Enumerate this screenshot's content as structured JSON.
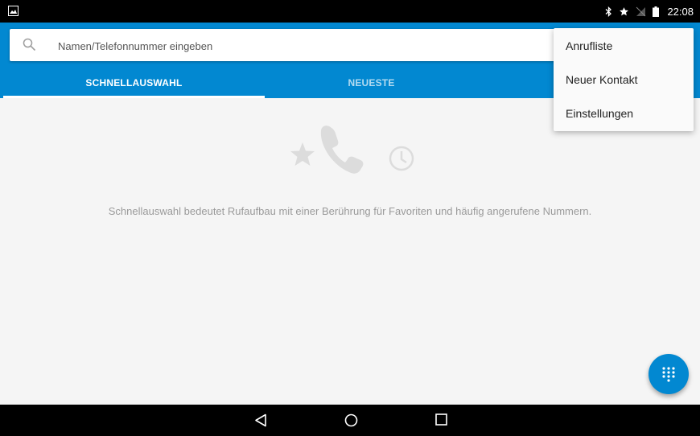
{
  "status_bar": {
    "time": "22:08",
    "icons": [
      "image-notification-icon",
      "bluetooth-icon",
      "star-icon",
      "no-signal-icon",
      "battery-icon"
    ]
  },
  "search": {
    "placeholder": "Namen/Telefonnummer eingeben",
    "value": ""
  },
  "tabs": [
    {
      "label": "SCHNELLAUSWAHL",
      "selected": true
    },
    {
      "label": "NEUESTE",
      "selected": false
    }
  ],
  "empty_state": {
    "message": "Schnellauswahl bedeutet Rufaufbau mit einer Berührung für Favoriten und häufig angerufene Nummern."
  },
  "overflow_menu": {
    "items": [
      {
        "label": "Anrufliste"
      },
      {
        "label": "Neuer Kontakt"
      },
      {
        "label": "Einstellungen"
      }
    ]
  },
  "fab": {
    "icon": "dialpad-icon"
  },
  "navigation": {
    "buttons": [
      "back-icon",
      "home-icon",
      "recents-icon"
    ]
  },
  "colors": {
    "primary": "#0288d1",
    "background": "#f5f5f5",
    "empty_text": "#9a9a9a"
  }
}
